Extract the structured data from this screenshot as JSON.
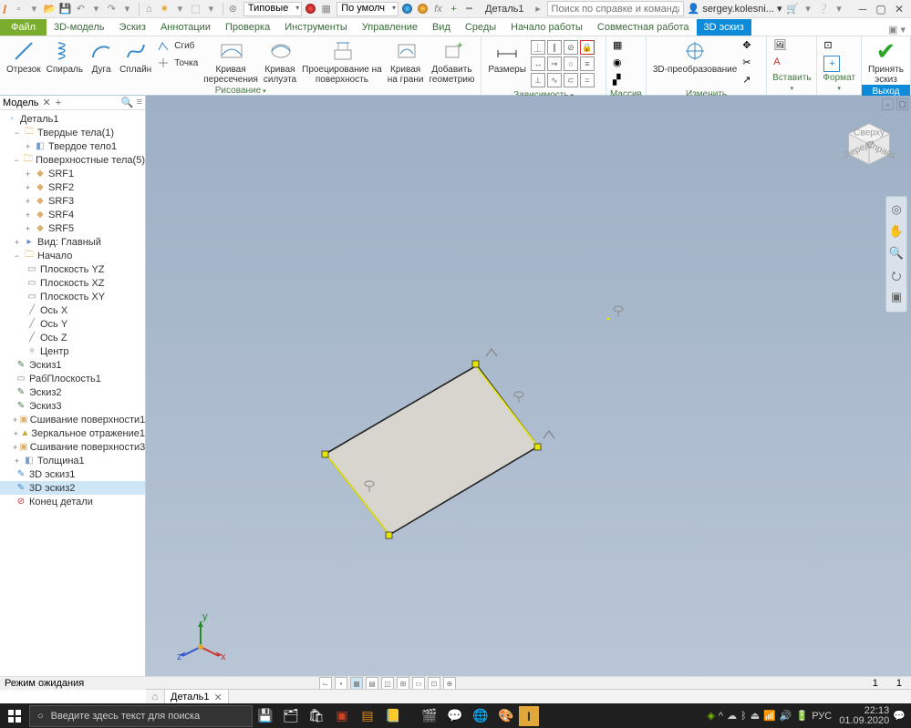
{
  "title": {
    "styles_label": "Типовые",
    "material_label": "По умолч",
    "doc": "Деталь1",
    "search_placeholder": "Поиск по справке и командам.",
    "user": "sergey.kolesni..."
  },
  "tabs": {
    "file": "Файл",
    "items": [
      "3D-модель",
      "Эскиз",
      "Аннотации",
      "Проверка",
      "Инструменты",
      "Управление",
      "Вид",
      "Среды",
      "Начало работы",
      "Совместная работа",
      "3D эскиз"
    ],
    "active": "3D эскиз"
  },
  "ribbon": {
    "draw": {
      "line": "Отрезок",
      "helix": "Спираль",
      "arc": "Дуга",
      "spline": "Сплайн",
      "bend": "Сгиб",
      "point": "Точка",
      "curve_intersect": "Кривая\nпересечения",
      "curve_silhouette": "Кривая\nсилуэта",
      "project_surface": "Проецирование на\nповерхность",
      "curve_face": "Кривая\nна грани",
      "add_geom": "Добавить\nгеометрию",
      "label": "Рисование"
    },
    "dim": {
      "dims": "Размеры",
      "label": "Зависимость"
    },
    "array": {
      "label": "Массив"
    },
    "transform": {
      "t3d": "3D-преобразование",
      "label": "Изменить"
    },
    "insert": {
      "label": "Вставить"
    },
    "format": {
      "label": "Формат"
    },
    "exit": {
      "accept": "Принять\nэскиз",
      "label": "Выход"
    }
  },
  "browser": {
    "title": "Модель",
    "root": "Деталь1",
    "solids": "Твердые тела(1)",
    "solid1": "Твердое тело1",
    "surfaces": "Поверхностные тела(5)",
    "srf": [
      "SRF1",
      "SRF2",
      "SRF3",
      "SRF4",
      "SRF5"
    ],
    "view": "Вид: Главный",
    "origin": "Начало",
    "planes": [
      "Плоскость YZ",
      "Плоскость XZ",
      "Плоскость XY"
    ],
    "axes": [
      "Ось X",
      "Ось Y",
      "Ось Z"
    ],
    "center": "Центр",
    "items": [
      "Эскиз1",
      "РабПлоскость1",
      "Эскиз2",
      "Эскиз3",
      "Сшивание поверхности1",
      "Зеркальное отражение1",
      "Сшивание поверхности3",
      "Толщина1",
      "3D эскиз1",
      "3D эскиз2"
    ],
    "end": "Конец детали"
  },
  "doctab": "Деталь1",
  "status": {
    "msg": "Режим ожидания",
    "n1": "1",
    "n2": "1"
  },
  "taskbar": {
    "search": "Введите здесь текст для поиска",
    "lang_code": "РУС",
    "time": "22:13",
    "date": "01.09.2020"
  },
  "viewcube": {
    "top": "Сверху",
    "front": "Спереди",
    "right": "Справа"
  }
}
